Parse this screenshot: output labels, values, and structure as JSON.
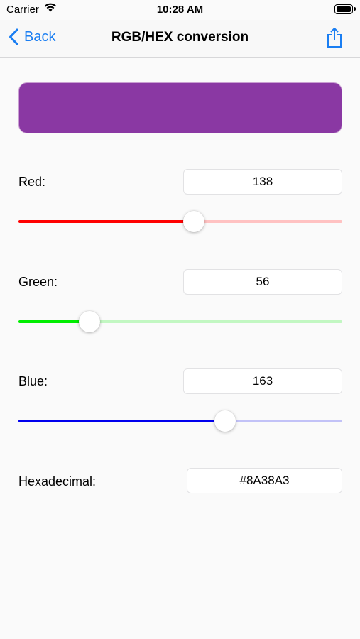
{
  "status_bar": {
    "carrier": "Carrier",
    "time": "10:28 AM"
  },
  "nav": {
    "back_label": "Back",
    "title": "RGB/HEX conversion",
    "share_icon": "share-icon"
  },
  "color": {
    "hex": "#8A38A3",
    "accent": "#1a7ef2"
  },
  "red": {
    "label": "Red:",
    "value": "138",
    "fraction": 0.541,
    "fill_color": "#ff0000",
    "track_color": "#ffc2c2"
  },
  "green": {
    "label": "Green:",
    "value": "56",
    "fraction": 0.22,
    "fill_color": "#00ee00",
    "track_color": "#c2f7c2"
  },
  "blue": {
    "label": "Blue:",
    "value": "163",
    "fraction": 0.639,
    "fill_color": "#0000ee",
    "track_color": "#c2c2f7"
  },
  "hexadecimal": {
    "label": "Hexadecimal:",
    "value": "#8A38A3"
  }
}
